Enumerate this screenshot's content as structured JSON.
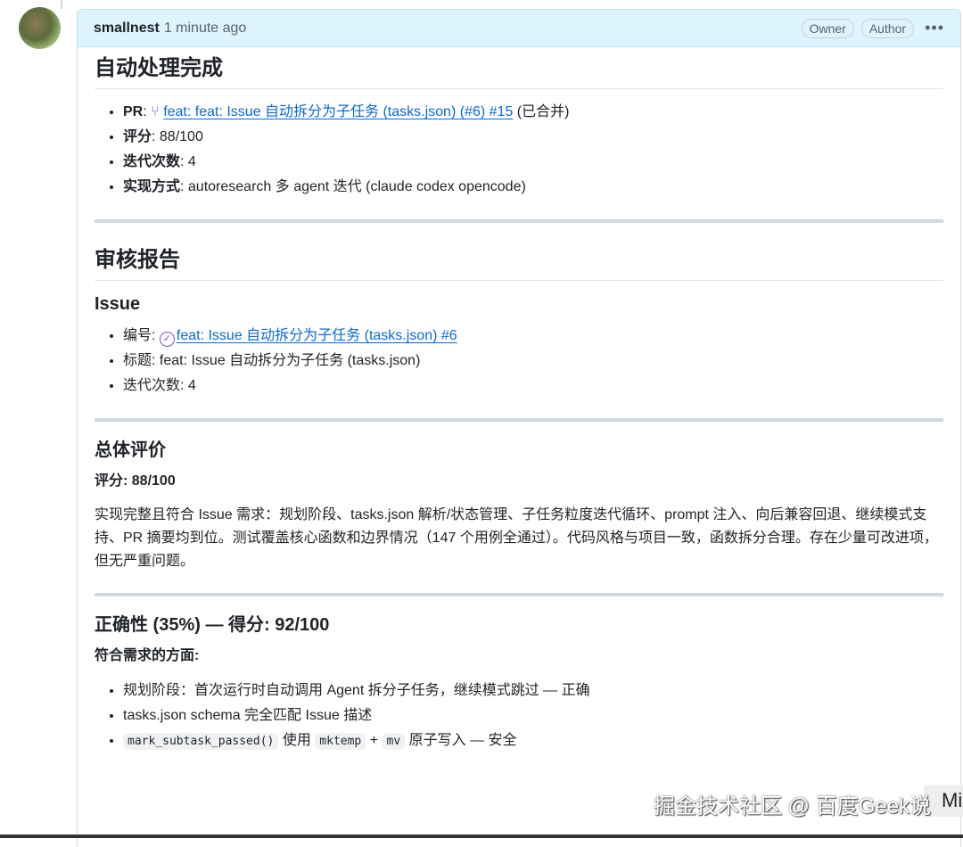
{
  "comment": {
    "author": "smallnest",
    "time": "1 minute ago",
    "badges": [
      "Owner",
      "Author"
    ],
    "more_icon": "kebab-horizontal-icon"
  },
  "summary": {
    "title": "自动处理完成",
    "pr_label": "PR",
    "pr_link": "feat: feat: Issue 自动拆分为子任务 (tasks.json) (#6) #15",
    "pr_status": "(已合并)",
    "score_label": "评分",
    "score": "88/100",
    "iter_label": "迭代次数",
    "iter": "4",
    "impl_label": "实现方式",
    "impl": "autoresearch 多 agent 迭代 (claude codex opencode)"
  },
  "review": {
    "title": "审核报告",
    "issue": {
      "title": "Issue",
      "id_label": "编号:",
      "id_link": "feat: Issue 自动拆分为子任务 (tasks.json) #6",
      "title_line": "标题: feat: Issue 自动拆分为子任务 (tasks.json)",
      "iter_line": "迭代次数: 4"
    },
    "overall": {
      "title": "总体评价",
      "score": "评分: 88/100",
      "text": "实现完整且符合 Issue 需求：规划阶段、tasks.json 解析/状态管理、子任务粒度迭代循环、prompt 注入、向后兼容回退、继续模式支持、PR 摘要均到位。测试覆盖核心函数和边界情况（147 个用例全通过）。代码风格与项目一致，函数拆分合理。存在少量可改进项，但无严重问题。"
    },
    "correctness": {
      "title": "正确性 (35%) — 得分: 92/100",
      "subtitle": "符合需求的方面:",
      "items": [
        "规划阶段：首次运行时自动调用 Agent 拆分子任务，继续模式跳过 — 正确",
        "tasks.json schema 完全匹配 Issue 描述"
      ],
      "code_item": {
        "code1": "mark_subtask_passed()",
        "t1": "使用",
        "code2": "mktemp",
        "t2": "+",
        "code3": "mv",
        "t3": "原子写入 — 安全"
      }
    }
  },
  "overlay": {
    "watermark": "掘金技术社区 @ 百度Geek说",
    "side_tab": "Mi"
  }
}
